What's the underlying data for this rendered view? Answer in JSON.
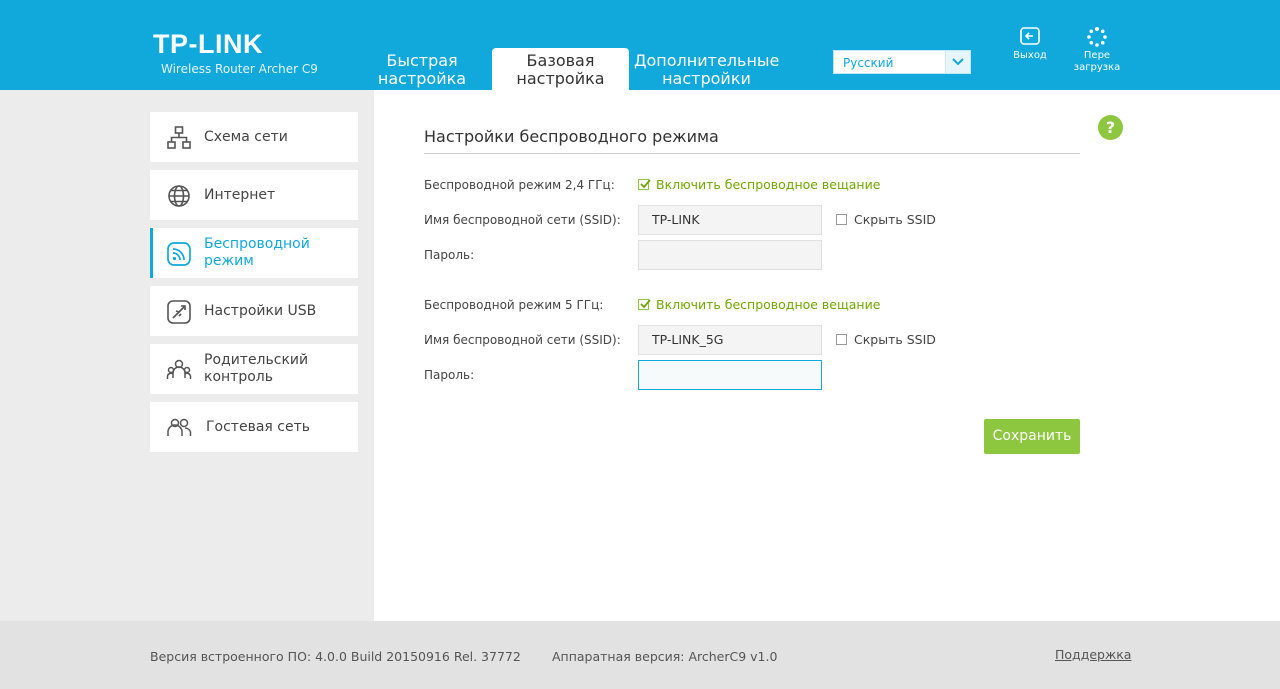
{
  "header": {
    "logo": "TP-LINK",
    "subtitle": "Wireless Router Archer C9",
    "tabs": [
      {
        "line1": "Быстрая",
        "line2": "настройка"
      },
      {
        "line1": "Базовая",
        "line2": "настройка"
      },
      {
        "line1": "Дополнительные",
        "line2": "настройки"
      }
    ],
    "active_tab": 1,
    "language": "Русский",
    "logout_label": "Выход",
    "reboot_line1": "Пере",
    "reboot_line2": "загрузка"
  },
  "sidebar": {
    "items": [
      {
        "line1": "Схема сети",
        "line2": "",
        "icon": "network-map-icon"
      },
      {
        "line1": "Интернет",
        "line2": "",
        "icon": "globe-icon"
      },
      {
        "line1": "Беспроводной",
        "line2": "режим",
        "icon": "wireless-icon"
      },
      {
        "line1": "Настройки USB",
        "line2": "",
        "icon": "usb-icon"
      },
      {
        "line1": "Родительский",
        "line2": "контроль",
        "icon": "parental-icon"
      },
      {
        "line1": "Гостевая сеть",
        "line2": "",
        "icon": "guest-icon"
      }
    ],
    "active_item": 2
  },
  "main": {
    "title": "Настройки беспроводного режима",
    "band24": {
      "mode_label": "Беспроводной режим 2,4 ГГц:",
      "enable_label": "Включить беспроводное вещание",
      "enabled": true,
      "ssid_label": "Имя беспроводной сети (SSID):",
      "ssid_value": "TP-LINK",
      "hide_ssid_label": "Скрыть SSID",
      "hide_ssid": false,
      "password_label": "Пароль:",
      "password_value": ""
    },
    "band5": {
      "mode_label": "Беспроводной режим 5 ГГц:",
      "enable_label": "Включить беспроводное вещание",
      "enabled": true,
      "ssid_label": "Имя беспроводной сети (SSID):",
      "ssid_value": "TP-LINK_5G",
      "hide_ssid_label": "Скрыть SSID",
      "hide_ssid": false,
      "password_label": "Пароль:",
      "password_value": ""
    },
    "save_label": "Сохранить",
    "help_label": "?"
  },
  "footer": {
    "firmware": "Версия встроенного ПО: 4.0.0 Build 20150916 Rel. 37772",
    "hardware": "Аппаратная версия: ArcherC9 v1.0",
    "support": "Поддержка"
  },
  "colors": {
    "brand_blue": "#11a8dc",
    "accent_green": "#8dc63f",
    "check_green": "#70a800"
  }
}
